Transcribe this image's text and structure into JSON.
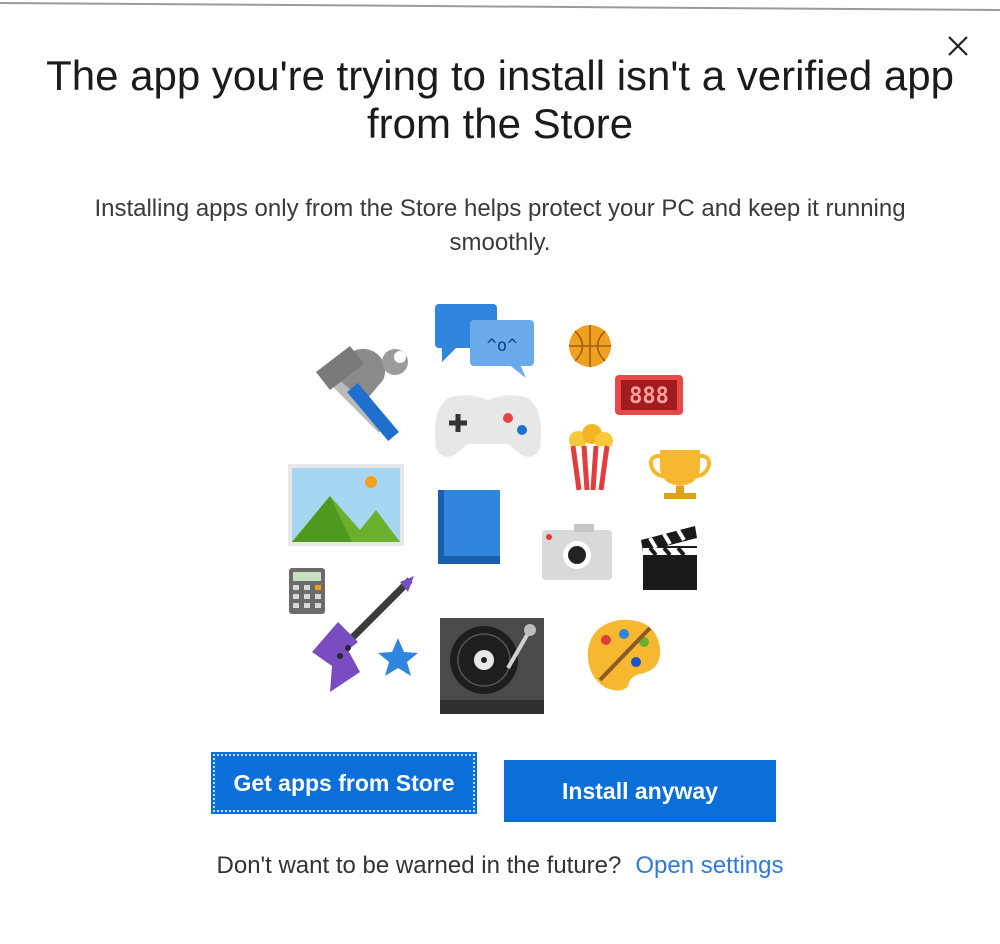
{
  "dialog": {
    "title": "The app you're trying to install isn't a verified app from the Store",
    "subtitle": "Installing apps only from the Store helps protect your PC and keep it running smoothly.",
    "close_icon": "close-icon"
  },
  "illustration": {
    "icons": [
      "chat-bubbles-icon",
      "basketball-icon",
      "hammer-wrench-icon",
      "scoreboard-icon",
      "gamepad-icon",
      "popcorn-icon",
      "trophy-icon",
      "photo-icon",
      "book-icon",
      "camera-icon",
      "clapperboard-icon",
      "calculator-icon",
      "guitar-icon",
      "star-icon",
      "turntable-icon",
      "palette-icon"
    ],
    "chat_text": "^o^",
    "scoreboard_text": "888"
  },
  "actions": {
    "primary_label": "Get apps from Store",
    "secondary_label": "Install anyway"
  },
  "footer": {
    "question": "Don't want to be warned in the future?",
    "link": "Open settings"
  },
  "colors": {
    "accent": "#0a6fd8",
    "link": "#2f7ad6"
  }
}
